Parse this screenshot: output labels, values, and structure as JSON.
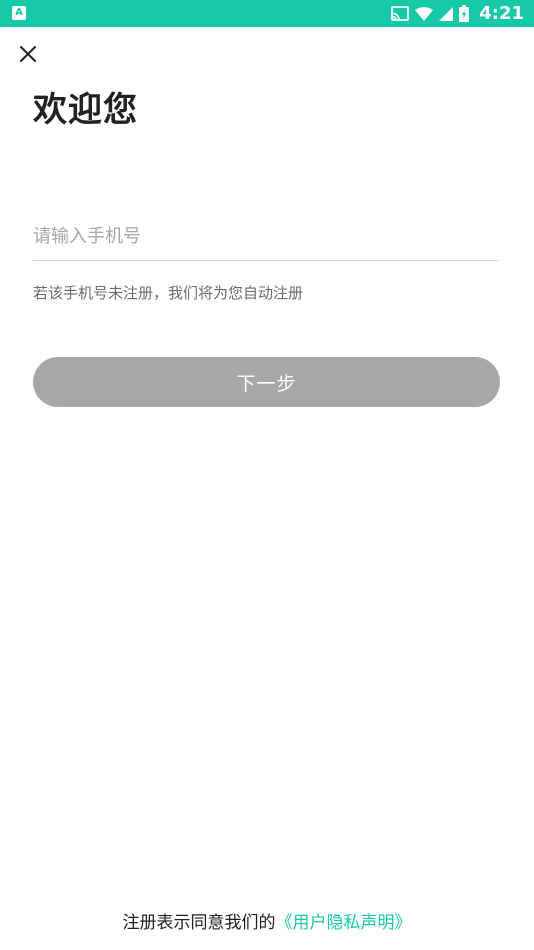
{
  "status_bar": {
    "left_icon_letter": "A",
    "time": "4:21",
    "background_color": "#18c9a7",
    "icons": [
      "cast-icon",
      "wifi-icon",
      "cellular-signal-icon",
      "battery-icon"
    ]
  },
  "header": {
    "close_icon": "close-icon",
    "title": "欢迎您"
  },
  "form": {
    "phone_placeholder": "请输入手机号",
    "phone_value": "",
    "hint": "若该手机号未注册，我们将为您自动注册",
    "next_button_label": "下一步",
    "next_button_color": "#a8a8a8"
  },
  "footer": {
    "agreement_text": "注册表示同意我们的",
    "policy_link_text": "《用户隐私声明》",
    "link_color": "#18c9a7"
  }
}
